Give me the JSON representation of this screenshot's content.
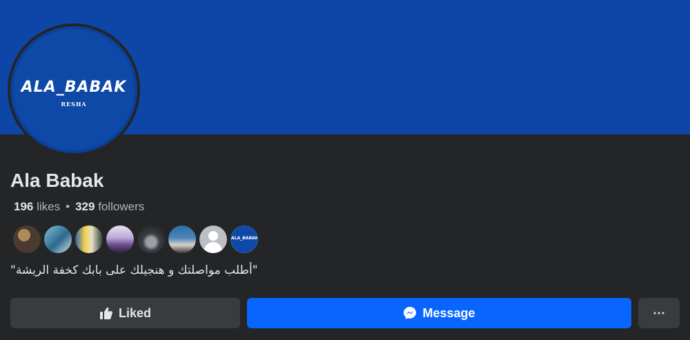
{
  "page": {
    "name": "Ala Babak",
    "logo": {
      "text": "ALA_BABAK",
      "subtext": "RESHA"
    },
    "stats": {
      "likes_count": "196",
      "likes_label": "likes",
      "separator": "•",
      "followers_count": "329",
      "followers_label": "followers"
    },
    "friends_avatars": [
      {
        "name": "friend-avatar-1"
      },
      {
        "name": "friend-avatar-2"
      },
      {
        "name": "friend-avatar-3"
      },
      {
        "name": "friend-avatar-4"
      },
      {
        "name": "friend-avatar-5"
      },
      {
        "name": "friend-avatar-6"
      },
      {
        "name": "friend-avatar-default"
      },
      {
        "name": "friend-avatar-ala-babak",
        "mini_text": "ALA_BABAK"
      }
    ],
    "bio": "\"أطلب مواصلتك و هنجيلك على بابك كخفة الريشة\""
  },
  "actions": {
    "liked_label": "Liked",
    "message_label": "Message",
    "more_label": "⋯"
  },
  "colors": {
    "cover": "#0d46a6",
    "background": "#242526",
    "primary_button": "#0866ff",
    "secondary_button": "#3a3b3c"
  },
  "icons": {
    "liked": "thumbs-up-icon",
    "message": "messenger-icon",
    "more": "more-horizontal-icon"
  }
}
